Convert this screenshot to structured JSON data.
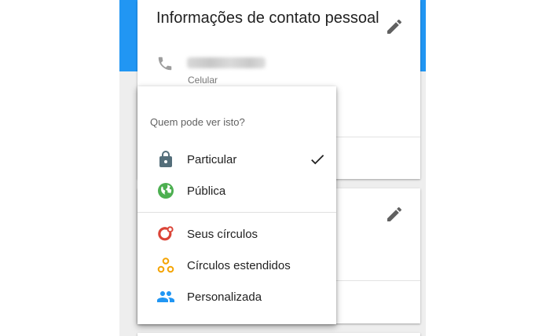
{
  "contact_card": {
    "title": "Informações de contato pessoal",
    "phone_type": "Celular",
    "edit_icon": "pencil-icon",
    "phone_icon": "phone-icon"
  },
  "visibility_menu": {
    "heading": "Quem pode ver isto?",
    "selected": "Particular",
    "items": [
      {
        "label": "Particular",
        "icon": "lock-icon",
        "color": "#546e7a",
        "checked": true
      },
      {
        "label": "Pública",
        "icon": "globe-icon",
        "color": "#4caf50",
        "checked": false
      },
      {
        "label": "Seus círculos",
        "icon": "circles-icon",
        "color": "#db4437",
        "checked": false
      },
      {
        "label": "Círculos estendidos",
        "icon": "extended-circles-icon",
        "color": "#f4a300",
        "checked": false
      },
      {
        "label": "Personalizada",
        "icon": "people-icon",
        "color": "#2196f3",
        "checked": false
      }
    ]
  },
  "colors": {
    "header_blue": "#2196f3",
    "page_background": "#eeeeee"
  }
}
